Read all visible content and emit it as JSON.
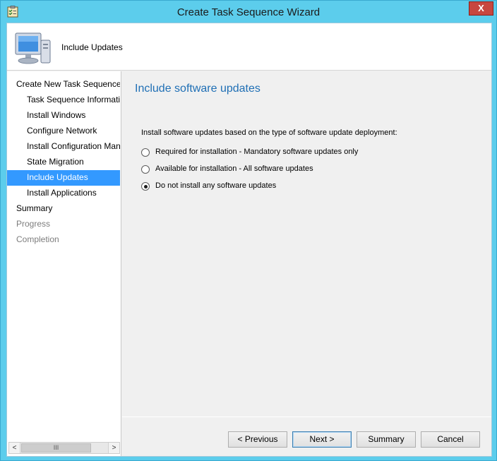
{
  "window": {
    "title": "Create Task Sequence Wizard",
    "close_label": "X"
  },
  "header": {
    "title": "Include Updates",
    "icon": "computer-icon"
  },
  "nav": {
    "items": [
      {
        "label": "Create New Task Sequence",
        "level": 0,
        "state": "normal"
      },
      {
        "label": "Task Sequence Information",
        "level": 1,
        "state": "normal"
      },
      {
        "label": "Install Windows",
        "level": 1,
        "state": "normal"
      },
      {
        "label": "Configure Network",
        "level": 1,
        "state": "normal"
      },
      {
        "label": "Install Configuration Manager",
        "level": 1,
        "state": "normal"
      },
      {
        "label": "State Migration",
        "level": 1,
        "state": "normal"
      },
      {
        "label": "Include Updates",
        "level": 1,
        "state": "selected"
      },
      {
        "label": "Install Applications",
        "level": 1,
        "state": "normal"
      },
      {
        "label": "Summary",
        "level": 0,
        "state": "normal"
      },
      {
        "label": "Progress",
        "level": 0,
        "state": "disabled"
      },
      {
        "label": "Completion",
        "level": 0,
        "state": "disabled"
      }
    ],
    "scroll": {
      "left": "<",
      "thumb": "III",
      "right": ">"
    }
  },
  "main": {
    "title": "Include software updates",
    "prompt": "Install software updates based on the type of software update deployment:",
    "options": [
      {
        "label": "Required for installation - Mandatory software updates only",
        "checked": false
      },
      {
        "label": "Available for installation - All software updates",
        "checked": false
      },
      {
        "label": "Do not install any software updates",
        "checked": true
      }
    ]
  },
  "buttons": {
    "previous": "< Previous",
    "next": "Next >",
    "summary": "Summary",
    "cancel": "Cancel"
  },
  "colors": {
    "title_bar": "#5ccdec",
    "selection": "#3399ff",
    "heading": "#1f6fb5",
    "close": "#c7473f"
  }
}
